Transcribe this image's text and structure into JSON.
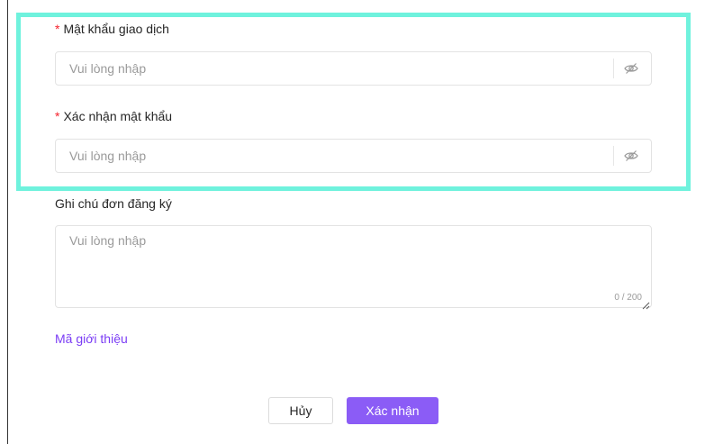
{
  "form": {
    "password": {
      "required_mark": "*",
      "label": "Mật khẩu giao dịch",
      "value": "",
      "placeholder": "Vui lòng nhập",
      "toggle_icon": "eye-slash-icon"
    },
    "confirm_password": {
      "required_mark": "*",
      "label": "Xác nhận mật khẩu",
      "value": "",
      "placeholder": "Vui lòng nhập",
      "toggle_icon": "eye-slash-icon"
    },
    "note": {
      "label": "Ghi chú đơn đăng ký",
      "value": "",
      "placeholder": "Vui lòng nhập",
      "counter": "0 / 200"
    },
    "referral_link": "Mã giới thiệu"
  },
  "actions": {
    "cancel_label": "Hủy",
    "confirm_label": "Xác nhận"
  },
  "colors": {
    "accent": "#8b5cf6",
    "link": "#7b3df5",
    "required": "#f5222d",
    "highlight": "#6ff2dd"
  }
}
